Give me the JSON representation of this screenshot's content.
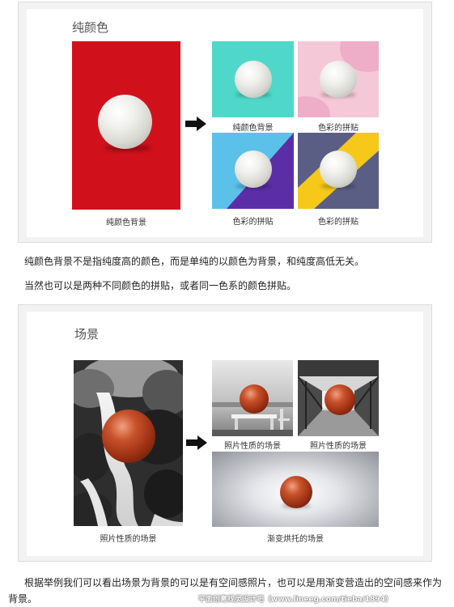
{
  "section1": {
    "title": "纯颜色",
    "captions": {
      "main": "纯颜色背景",
      "teal": "纯颜色背景",
      "pink": "色彩的拼贴",
      "purple": "色彩的拼贴",
      "yellow": "色彩的拼贴"
    },
    "colors": {
      "red": "#d0111b",
      "teal": "#4fd8c9",
      "pink": "#f5c8d8",
      "blue": "#5bc1e8",
      "violet": "#5b2ea6",
      "slate": "#5b5e84",
      "yellow": "#f6c81a"
    }
  },
  "paragraphs": {
    "p1": "纯颜色背景不是指纯度高的颜色，而是单纯的以颜色为背景，和纯度高低无关。",
    "p2": "当然也可以是两种不同颜色的拼贴，或者同一色系的颜色拼贴。",
    "p3": "根据举例我们可以看出场景为背景的可以是有空间感照片，也可以是用渐变营造出的空间感来作为背景。"
  },
  "section2": {
    "title": "场景",
    "captions": {
      "main": "照片性质的场景",
      "table": "照片性质的场景",
      "bridge": "照片性质的场景",
      "gradient": "渐变烘托的场景"
    }
  },
  "watermark": "平面创意找灵设计吧（www.lineeg.com/tieba/1894）"
}
